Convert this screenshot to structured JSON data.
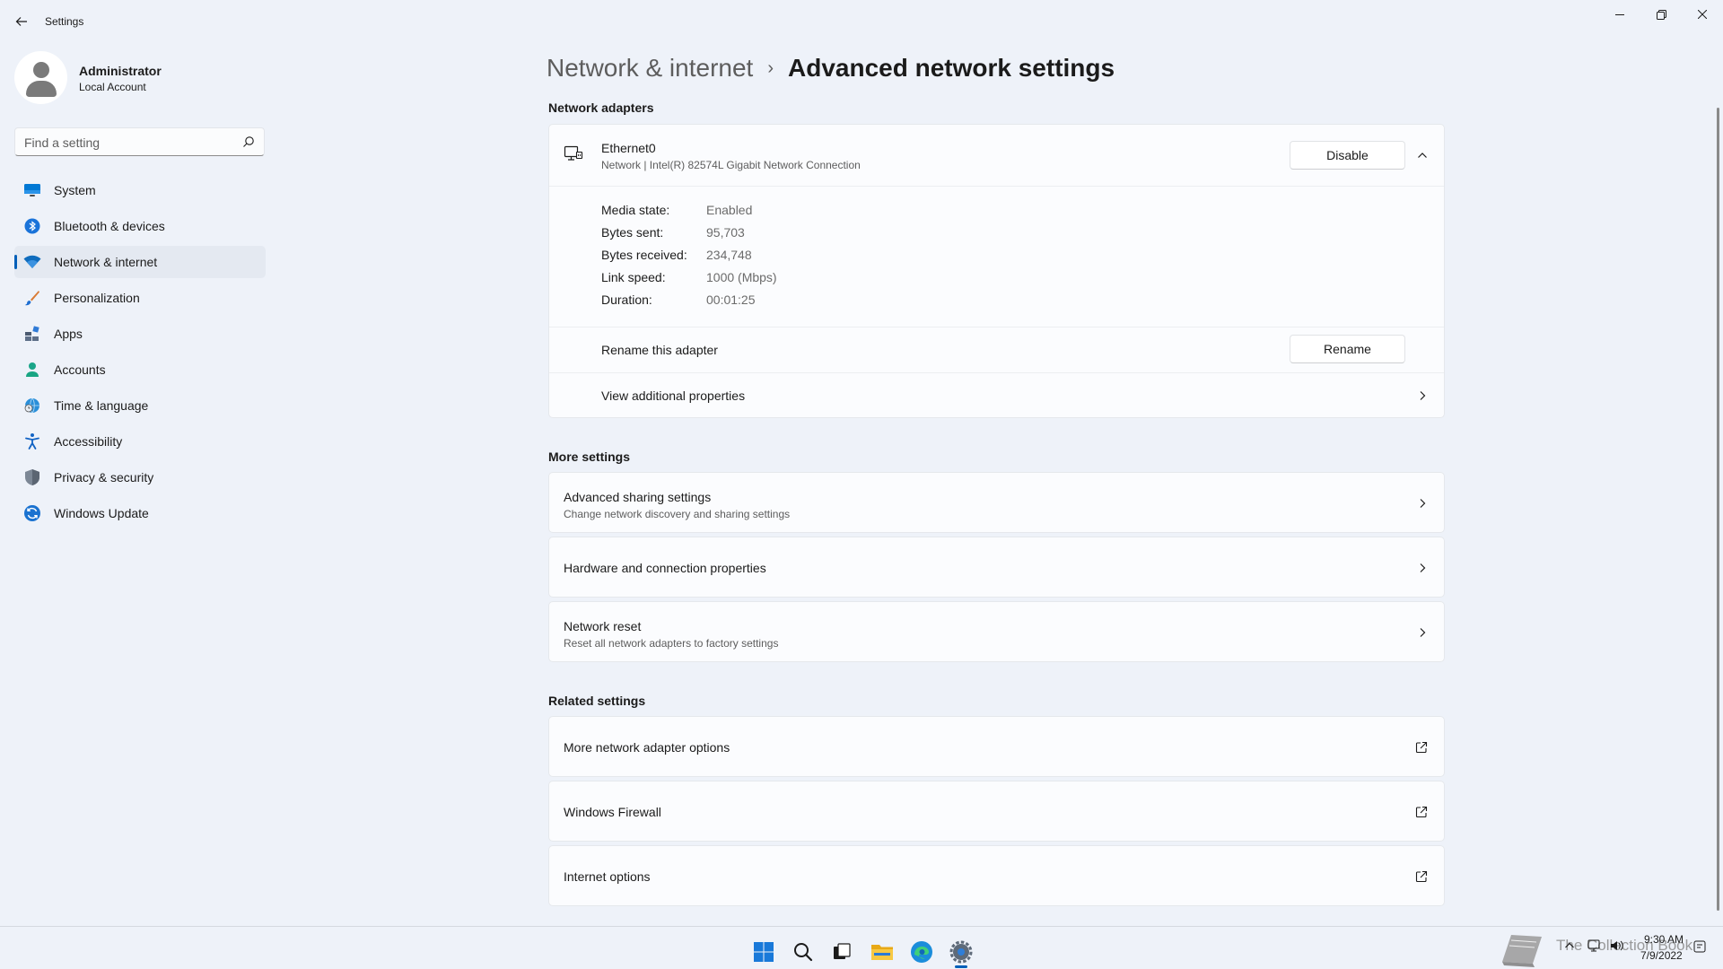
{
  "window": {
    "app_title": "Settings",
    "controls": {
      "minimize": "minimize-icon",
      "maximize": "restore-icon",
      "close": "close-icon"
    }
  },
  "profile": {
    "name": "Administrator",
    "account_type": "Local Account"
  },
  "search": {
    "placeholder": "Find a setting"
  },
  "sidebar": {
    "items": [
      {
        "label": "System",
        "icon": "monitor-icon",
        "active": false
      },
      {
        "label": "Bluetooth & devices",
        "icon": "bluetooth-icon",
        "active": false
      },
      {
        "label": "Network & internet",
        "icon": "wifi-icon",
        "active": true
      },
      {
        "label": "Personalization",
        "icon": "brush-icon",
        "active": false
      },
      {
        "label": "Apps",
        "icon": "apps-icon",
        "active": false
      },
      {
        "label": "Accounts",
        "icon": "person-icon",
        "active": false
      },
      {
        "label": "Time & language",
        "icon": "globe-clock-icon",
        "active": false
      },
      {
        "label": "Accessibility",
        "icon": "accessibility-icon",
        "active": false
      },
      {
        "label": "Privacy & security",
        "icon": "shield-icon",
        "active": false
      },
      {
        "label": "Windows Update",
        "icon": "update-icon",
        "active": false
      }
    ]
  },
  "breadcrumb": {
    "parent": "Network & internet",
    "separator": "›",
    "current": "Advanced network settings"
  },
  "network_adapters": {
    "heading": "Network adapters",
    "adapter": {
      "name": "Ethernet0",
      "description": "Network | Intel(R) 82574L Gigabit Network Connection",
      "disable_label": "Disable",
      "stats": [
        {
          "label": "Media state:",
          "value": "Enabled"
        },
        {
          "label": "Bytes sent:",
          "value": "95,703"
        },
        {
          "label": "Bytes received:",
          "value": "234,748"
        },
        {
          "label": "Link speed:",
          "value": "1000 (Mbps)"
        },
        {
          "label": "Duration:",
          "value": "00:01:25"
        }
      ],
      "rename_text": "Rename this adapter",
      "rename_label": "Rename",
      "view_props": "View additional properties"
    }
  },
  "more_settings": {
    "heading": "More settings",
    "items": [
      {
        "title": "Advanced sharing settings",
        "desc": "Change network discovery and sharing settings"
      },
      {
        "title": "Hardware and connection properties",
        "desc": ""
      },
      {
        "title": "Network reset",
        "desc": "Reset all network adapters to factory settings"
      }
    ]
  },
  "related_settings": {
    "heading": "Related settings",
    "items": [
      {
        "title": "More network adapter options"
      },
      {
        "title": "Windows Firewall"
      },
      {
        "title": "Internet options"
      }
    ]
  },
  "taskbar": {
    "icons": [
      "windows-start-icon",
      "search-icon",
      "task-view-icon",
      "file-explorer-icon",
      "edge-browser-icon",
      "settings-app-icon"
    ],
    "clock": {
      "time": "9:30 AM",
      "date": "7/9/2022"
    },
    "watermark": "The Collection Book"
  },
  "colors": {
    "accent": "#005fb8",
    "background": "#eef2f9",
    "card": "#fbfcfe"
  }
}
